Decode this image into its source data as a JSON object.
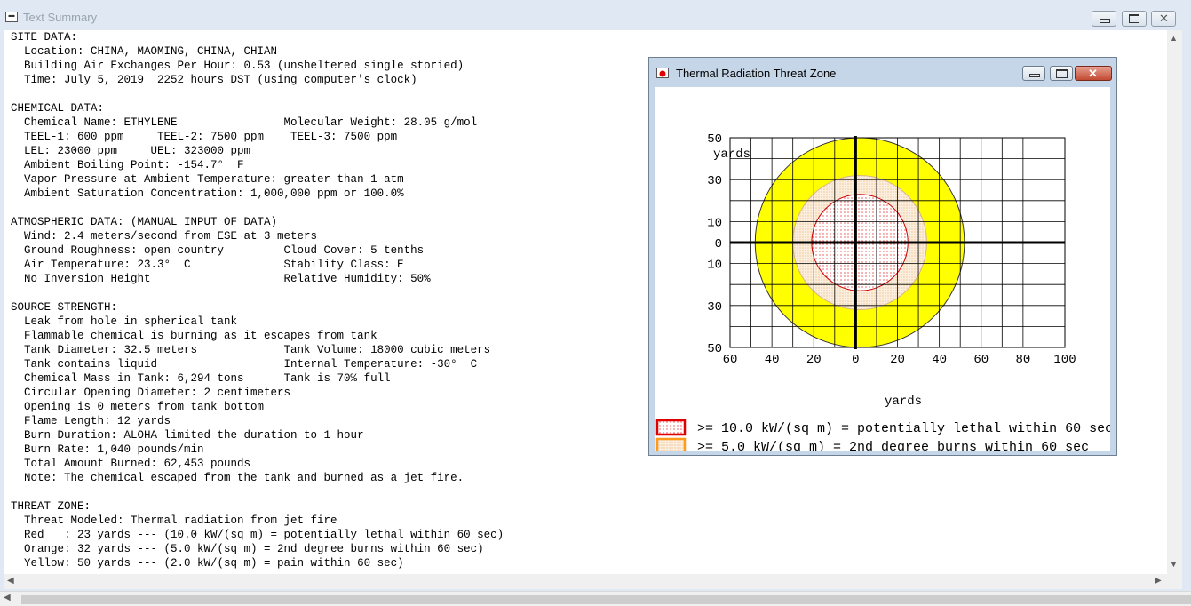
{
  "window": {
    "title": "Text Summary"
  },
  "report_text": "SITE DATA:\n  Location: CHINA, MAOMING, CHINA, CHIAN\n  Building Air Exchanges Per Hour: 0.53 (unsheltered single storied)\n  Time: July 5, 2019  2252 hours DST (using computer's clock)\n\nCHEMICAL DATA:\n  Chemical Name: ETHYLENE                Molecular Weight: 28.05 g/mol\n  TEEL-1: 600 ppm     TEEL-2: 7500 ppm    TEEL-3: 7500 ppm\n  LEL: 23000 ppm     UEL: 323000 ppm\n  Ambient Boiling Point: -154.7°  F\n  Vapor Pressure at Ambient Temperature: greater than 1 atm\n  Ambient Saturation Concentration: 1,000,000 ppm or 100.0%\n\nATMOSPHERIC DATA: (MANUAL INPUT OF DATA)\n  Wind: 2.4 meters/second from ESE at 3 meters\n  Ground Roughness: open country         Cloud Cover: 5 tenths\n  Air Temperature: 23.3°  C              Stability Class: E\n  No Inversion Height                    Relative Humidity: 50%\n\nSOURCE STRENGTH:\n  Leak from hole in spherical tank\n  Flammable chemical is burning as it escapes from tank\n  Tank Diameter: 32.5 meters             Tank Volume: 18000 cubic meters\n  Tank contains liquid                   Internal Temperature: -30°  C\n  Chemical Mass in Tank: 6,294 tons      Tank is 70% full\n  Circular Opening Diameter: 2 centimeters\n  Opening is 0 meters from tank bottom\n  Flame Length: 12 yards\n  Burn Duration: ALOHA limited the duration to 1 hour\n  Burn Rate: 1,040 pounds/min\n  Total Amount Burned: 62,453 pounds\n  Note: The chemical escaped from the tank and burned as a jet fire.\n\nTHREAT ZONE:\n  Threat Modeled: Thermal radiation from jet fire\n  Red   : 23 yards --- (10.0 kW/(sq m) = potentially lethal within 60 sec)\n  Orange: 32 yards --- (5.0 kW/(sq m) = 2nd degree burns within 60 sec)\n  Yellow: 50 yards --- (2.0 kW/(sq m) = pain within 60 sec)",
  "threat_window": {
    "title": "Thermal Radiation Threat Zone",
    "y_unit": "yards",
    "x_unit": "yards",
    "y_ticks": [
      "50",
      "30",
      "10",
      "0",
      "10",
      "30",
      "50"
    ],
    "x_ticks": [
      "60",
      "40",
      "20",
      "0",
      "20",
      "40",
      "60",
      "80",
      "100"
    ],
    "legend": [
      {
        "text": ">= 10.0 kW/(sq m) = potentially lethal within 60 sec",
        "color": "#ff0000"
      },
      {
        "text": ">= 5.0 kW/(sq m) = 2nd degree burns within 60 sec",
        "color": "#ff8c00"
      },
      {
        "text": ">= 2.0 kW/(sq m) = pain within 60 sec",
        "color": "#ffff00"
      }
    ]
  },
  "chart_data": {
    "type": "area",
    "title": "Thermal Radiation Threat Zone",
    "xlabel": "yards",
    "ylabel": "yards",
    "xlim": [
      -60,
      100
    ],
    "ylim": [
      -50,
      50
    ],
    "grid": true,
    "series": [
      {
        "name": ">= 10.0 kW/(sq m) = potentially lethal within 60 sec",
        "center": [
          2,
          0
        ],
        "radius": 23,
        "color": "#ff0000"
      },
      {
        "name": ">= 5.0 kW/(sq m) = 2nd degree burns within 60 sec",
        "center": [
          2,
          0
        ],
        "radius": 32,
        "color": "#ff8c00"
      },
      {
        "name": ">= 2.0 kW/(sq m) = pain within 60 sec",
        "center": [
          2,
          0
        ],
        "radius": 50,
        "color": "#ffff00"
      }
    ]
  }
}
